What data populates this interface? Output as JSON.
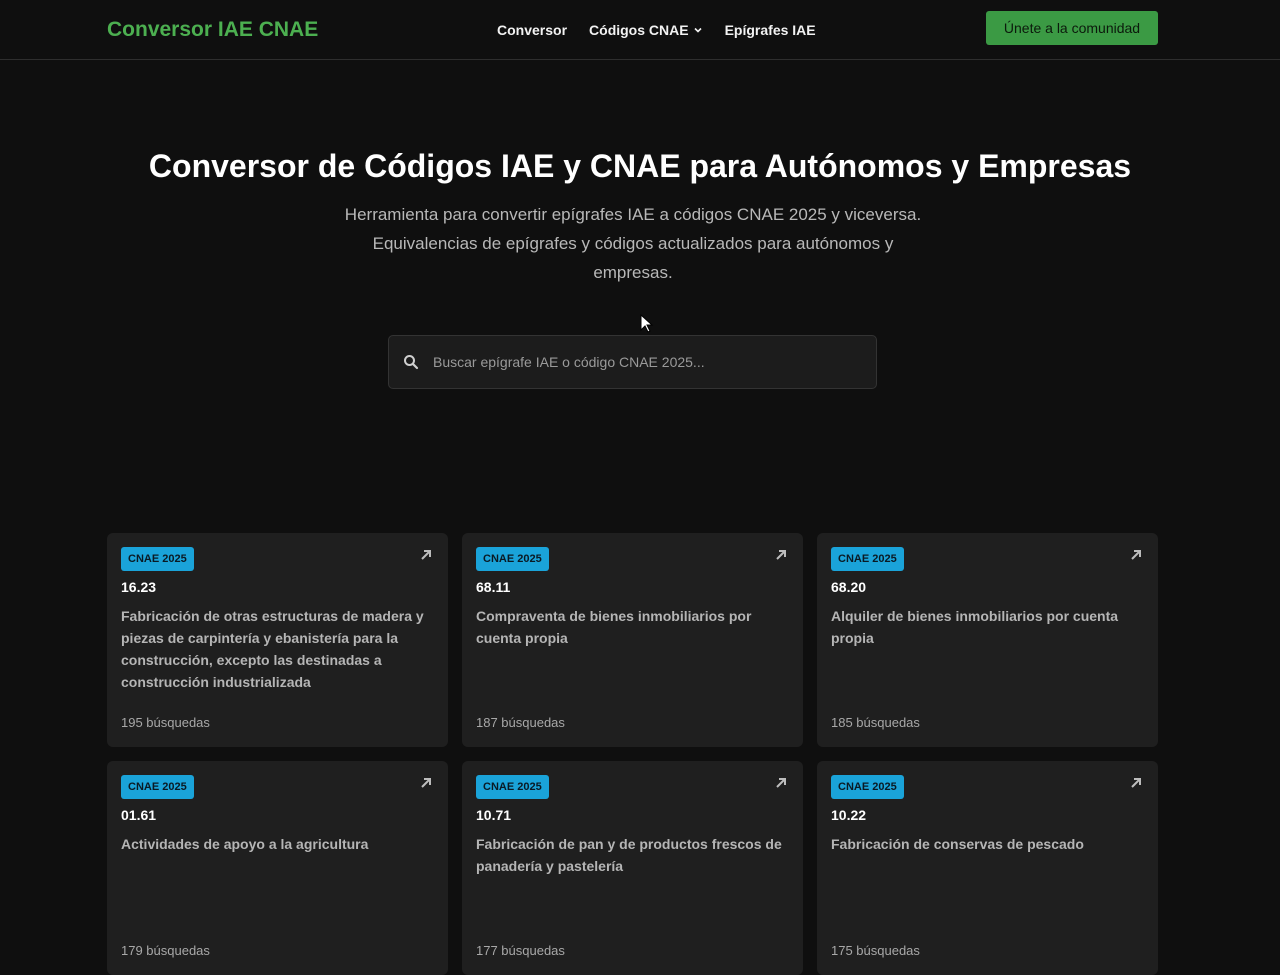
{
  "header": {
    "brand": "Conversor IAE CNAE",
    "nav": [
      {
        "label": "Conversor"
      },
      {
        "label": "Códigos CNAE"
      },
      {
        "label": "Epígrafes IAE"
      }
    ],
    "cta_label": "Únete a la comunidad"
  },
  "hero": {
    "title": "Conversor de Códigos IAE y CNAE para Autónomos y Empresas",
    "subtitle_line1": "Herramienta para convertir epígrafes IAE a códigos CNAE 2025 y viceversa.",
    "subtitle_line2": "Equivalencias de epígrafes y códigos actualizados para autónomos y",
    "subtitle_line3": "empresas."
  },
  "search": {
    "placeholder": "Buscar epígrafe IAE o código CNAE 2025..."
  },
  "colors": {
    "accent": "#4caf50",
    "badge": "#1aa3d9",
    "background": "#0f0f0f",
    "card": "#1f1f1f"
  },
  "cards": [
    {
      "badge": "CNAE 2025",
      "code": "16.23",
      "desc": "Fabricación de otras estructuras de madera y piezas de carpintería y ebanistería para la construcción, excepto las destinadas a construcción industrializada",
      "count": "195 búsquedas"
    },
    {
      "badge": "CNAE 2025",
      "code": "68.11",
      "desc": "Compraventa de bienes inmobiliarios por cuenta propia",
      "count": "187 búsquedas"
    },
    {
      "badge": "CNAE 2025",
      "code": "68.20",
      "desc": "Alquiler de bienes inmobiliarios por cuenta propia",
      "count": "185 búsquedas"
    },
    {
      "badge": "CNAE 2025",
      "code": "01.61",
      "desc": "Actividades de apoyo a la agricultura",
      "count": "179 búsquedas"
    },
    {
      "badge": "CNAE 2025",
      "code": "10.71",
      "desc": "Fabricación de pan y de productos frescos de panadería y pastelería",
      "count": "177 búsquedas"
    },
    {
      "badge": "CNAE 2025",
      "code": "10.22",
      "desc": "Fabricación de conservas de pescado",
      "count": "175 búsquedas"
    }
  ]
}
